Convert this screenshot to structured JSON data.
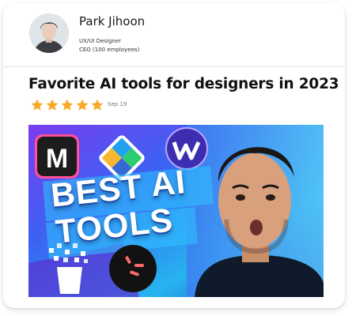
{
  "author": {
    "name": "Park Jihoon",
    "role": "UX/UI Designer",
    "company": "CEO (100 employees)"
  },
  "post": {
    "title": "Favorite AI tools for designers in 2023",
    "rating": 5,
    "rating_max": 5,
    "date": "Sep 19"
  },
  "thumbnail": {
    "line1": "BEST AI",
    "line2": "TOOLS",
    "badge_letter": "M",
    "icons": [
      "miro-m-logo-icon",
      "jira-diamond-icon",
      "webflow-w-logo-icon",
      "qr-bucket-icon",
      "spark-logo-icon"
    ]
  },
  "colors": {
    "star": "#f7a928",
    "title": "#111111",
    "thumbnail_bg": "#2a6cf0"
  }
}
